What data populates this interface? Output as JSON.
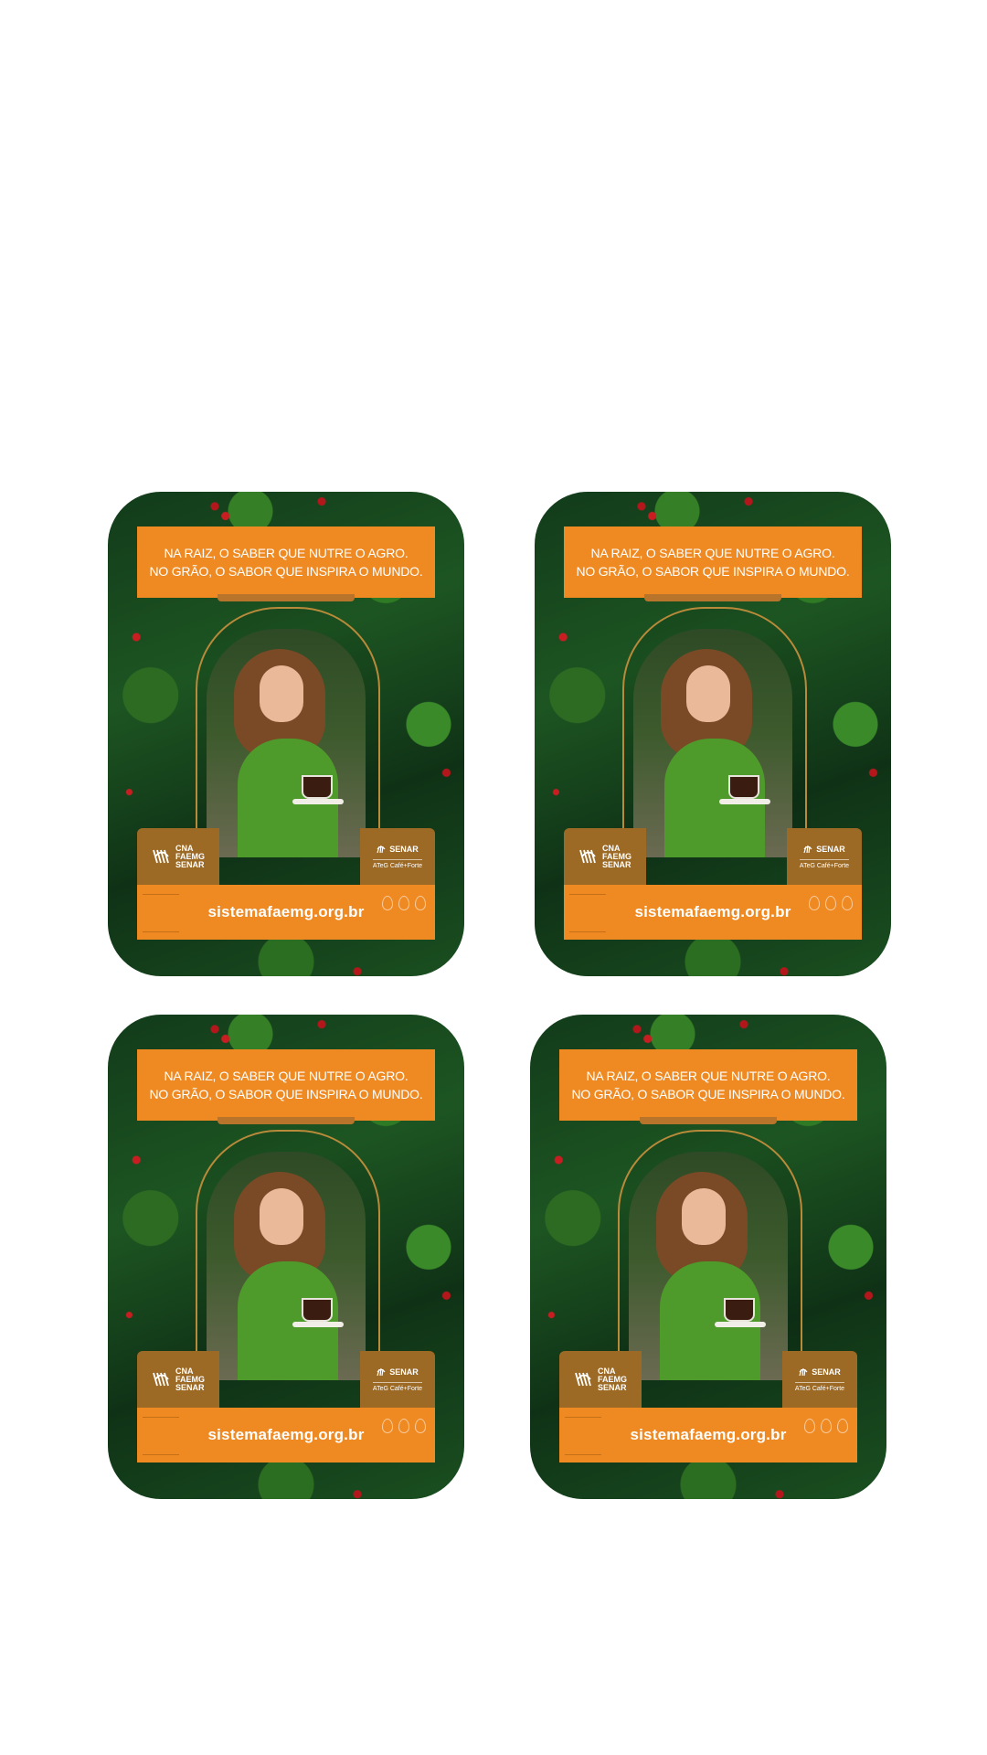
{
  "cards": [
    {
      "headline_line1": "NA RAIZ, O SABER QUE NUTRE O AGRO.",
      "headline_line2": "NO GRÃO, O SABOR QUE INSPIRA O MUNDO.",
      "logo_left": [
        "CNA",
        "FAEMG",
        "SENAR"
      ],
      "logo_right": "SENAR",
      "logo_right_sub": "ATeG Café+Forte",
      "url": "sistemafaemg.org.br"
    },
    {
      "headline_line1": "NA RAIZ, O SABER QUE NUTRE O AGRO.",
      "headline_line2": "NO GRÃO, O SABOR QUE INSPIRA O MUNDO.",
      "logo_left": [
        "CNA",
        "FAEMG",
        "SENAR"
      ],
      "logo_right": "SENAR",
      "logo_right_sub": "ATeG Café+Forte",
      "url": "sistemafaemg.org.br"
    },
    {
      "headline_line1": "NA RAIZ, O SABER QUE NUTRE O AGRO.",
      "headline_line2": "NO GRÃO, O SABOR QUE INSPIRA O MUNDO.",
      "logo_left": [
        "CNA",
        "FAEMG",
        "SENAR"
      ],
      "logo_right": "SENAR",
      "logo_right_sub": "ATeG Café+Forte",
      "url": "sistemafaemg.org.br"
    },
    {
      "headline_line1": "NA RAIZ, O SABER QUE NUTRE O AGRO.",
      "headline_line2": "NO GRÃO, O SABOR QUE INSPIRA O MUNDO.",
      "logo_left": [
        "CNA",
        "FAEMG",
        "SENAR"
      ],
      "logo_right": "SENAR",
      "logo_right_sub": "ATeG Café+Forte",
      "url": "sistemafaemg.org.br"
    }
  ],
  "colors": {
    "orange": "#ef8a23",
    "gold": "#9d6a25",
    "leaf_green": "#1d5522"
  },
  "icons": [
    "cna-faemg-senar-logo-icon",
    "senar-logo-icon",
    "coffee-cup-photo"
  ]
}
